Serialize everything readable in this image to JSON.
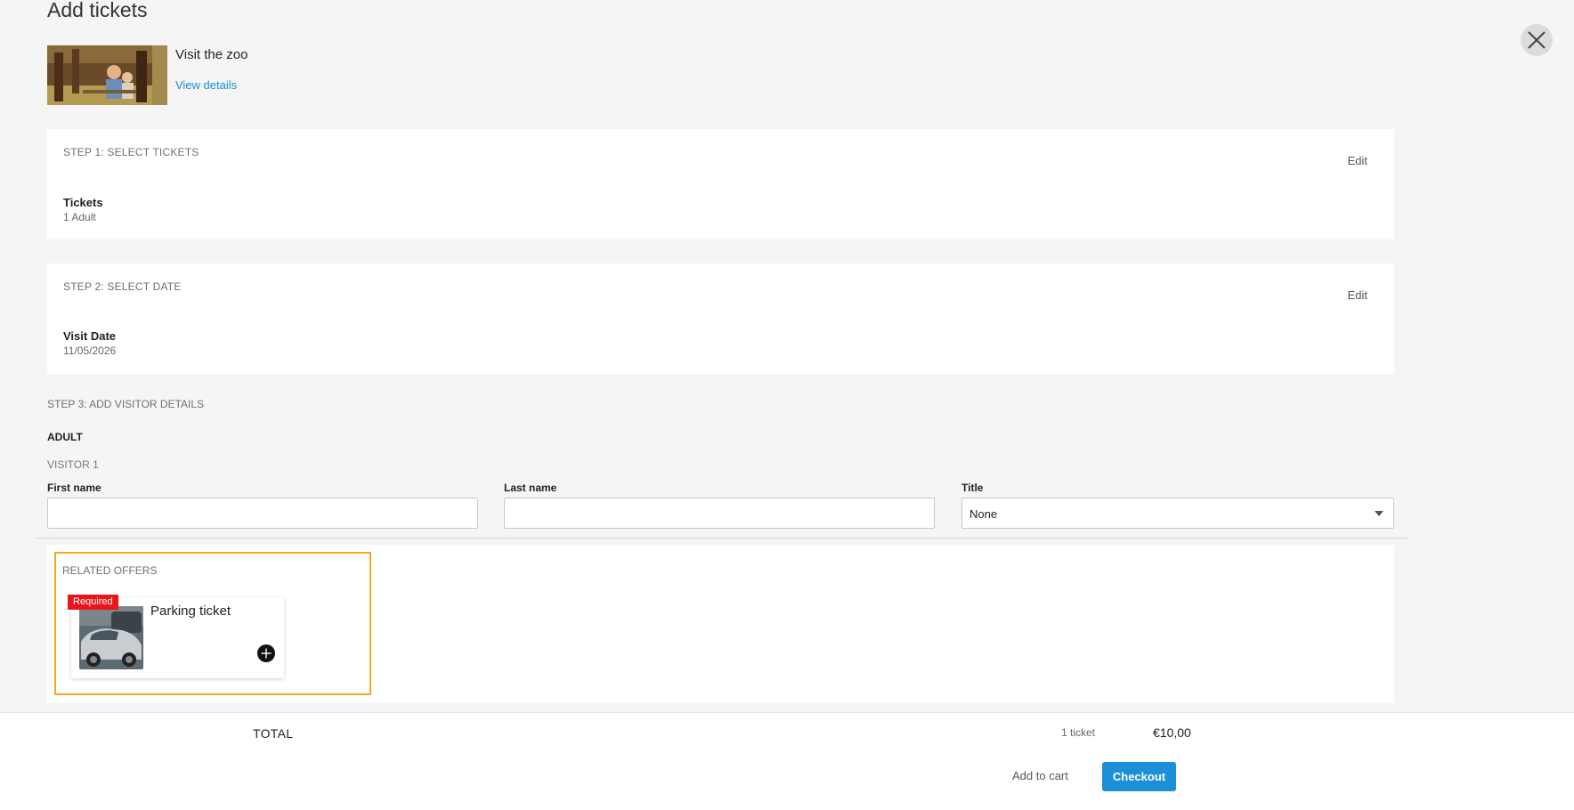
{
  "header": {
    "title": "Add tickets",
    "close_icon": "close-icon"
  },
  "offer": {
    "name": "Visit the zoo",
    "view_details_label": "View details"
  },
  "step1": {
    "title": "STEP 1: SELECT TICKETS",
    "edit_label": "Edit",
    "field_label": "Tickets",
    "field_value": "1 Adult"
  },
  "step2": {
    "title": "STEP 2: SELECT DATE",
    "edit_label": "Edit",
    "field_label": "Visit Date",
    "field_value": "11/05/2026"
  },
  "step3": {
    "title": "STEP 3: ADD VISITOR DETAILS",
    "group_label": "ADULT",
    "visitor_label": "VISITOR 1",
    "first_name_label": "First name",
    "first_name_value": "",
    "last_name_label": "Last name",
    "last_name_value": "",
    "title_label": "Title",
    "title_value": "None"
  },
  "related": {
    "title": "RELATED OFFERS",
    "items": [
      {
        "badge": "Required",
        "name": "Parking ticket",
        "add_icon": "plus-circle-icon"
      }
    ]
  },
  "footer": {
    "total_label": "TOTAL",
    "ticket_count": "1 ticket",
    "total_price": "€10,00",
    "add_to_cart_label": "Add to cart",
    "checkout_label": "Checkout"
  },
  "colors": {
    "accent": "#1b8fd8",
    "link": "#1a8ed6",
    "required_badge": "#e8161c",
    "highlight_border": "#f5a623"
  }
}
